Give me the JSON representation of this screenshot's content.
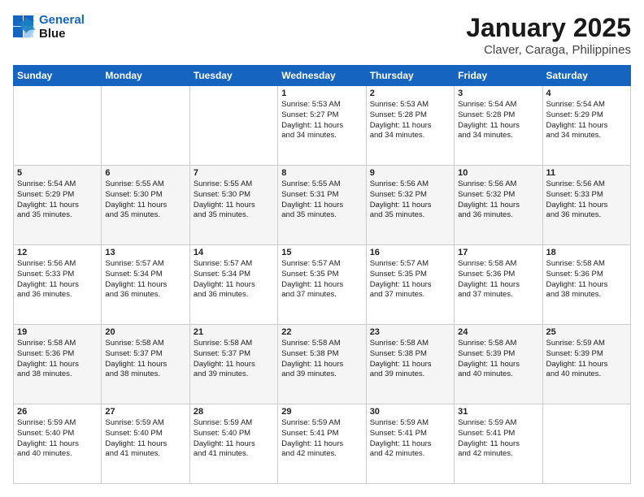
{
  "logo": {
    "line1": "General",
    "line2": "Blue"
  },
  "title": "January 2025",
  "subtitle": "Claver, Caraga, Philippines",
  "weekdays": [
    "Sunday",
    "Monday",
    "Tuesday",
    "Wednesday",
    "Thursday",
    "Friday",
    "Saturday"
  ],
  "weeks": [
    [
      {
        "day": "",
        "info": ""
      },
      {
        "day": "",
        "info": ""
      },
      {
        "day": "",
        "info": ""
      },
      {
        "day": "1",
        "info": "Sunrise: 5:53 AM\nSunset: 5:27 PM\nDaylight: 11 hours\nand 34 minutes."
      },
      {
        "day": "2",
        "info": "Sunrise: 5:53 AM\nSunset: 5:28 PM\nDaylight: 11 hours\nand 34 minutes."
      },
      {
        "day": "3",
        "info": "Sunrise: 5:54 AM\nSunset: 5:28 PM\nDaylight: 11 hours\nand 34 minutes."
      },
      {
        "day": "4",
        "info": "Sunrise: 5:54 AM\nSunset: 5:29 PM\nDaylight: 11 hours\nand 34 minutes."
      }
    ],
    [
      {
        "day": "5",
        "info": "Sunrise: 5:54 AM\nSunset: 5:29 PM\nDaylight: 11 hours\nand 35 minutes."
      },
      {
        "day": "6",
        "info": "Sunrise: 5:55 AM\nSunset: 5:30 PM\nDaylight: 11 hours\nand 35 minutes."
      },
      {
        "day": "7",
        "info": "Sunrise: 5:55 AM\nSunset: 5:30 PM\nDaylight: 11 hours\nand 35 minutes."
      },
      {
        "day": "8",
        "info": "Sunrise: 5:55 AM\nSunset: 5:31 PM\nDaylight: 11 hours\nand 35 minutes."
      },
      {
        "day": "9",
        "info": "Sunrise: 5:56 AM\nSunset: 5:32 PM\nDaylight: 11 hours\nand 35 minutes."
      },
      {
        "day": "10",
        "info": "Sunrise: 5:56 AM\nSunset: 5:32 PM\nDaylight: 11 hours\nand 36 minutes."
      },
      {
        "day": "11",
        "info": "Sunrise: 5:56 AM\nSunset: 5:33 PM\nDaylight: 11 hours\nand 36 minutes."
      }
    ],
    [
      {
        "day": "12",
        "info": "Sunrise: 5:56 AM\nSunset: 5:33 PM\nDaylight: 11 hours\nand 36 minutes."
      },
      {
        "day": "13",
        "info": "Sunrise: 5:57 AM\nSunset: 5:34 PM\nDaylight: 11 hours\nand 36 minutes."
      },
      {
        "day": "14",
        "info": "Sunrise: 5:57 AM\nSunset: 5:34 PM\nDaylight: 11 hours\nand 36 minutes."
      },
      {
        "day": "15",
        "info": "Sunrise: 5:57 AM\nSunset: 5:35 PM\nDaylight: 11 hours\nand 37 minutes."
      },
      {
        "day": "16",
        "info": "Sunrise: 5:57 AM\nSunset: 5:35 PM\nDaylight: 11 hours\nand 37 minutes."
      },
      {
        "day": "17",
        "info": "Sunrise: 5:58 AM\nSunset: 5:36 PM\nDaylight: 11 hours\nand 37 minutes."
      },
      {
        "day": "18",
        "info": "Sunrise: 5:58 AM\nSunset: 5:36 PM\nDaylight: 11 hours\nand 38 minutes."
      }
    ],
    [
      {
        "day": "19",
        "info": "Sunrise: 5:58 AM\nSunset: 5:36 PM\nDaylight: 11 hours\nand 38 minutes."
      },
      {
        "day": "20",
        "info": "Sunrise: 5:58 AM\nSunset: 5:37 PM\nDaylight: 11 hours\nand 38 minutes."
      },
      {
        "day": "21",
        "info": "Sunrise: 5:58 AM\nSunset: 5:37 PM\nDaylight: 11 hours\nand 39 minutes."
      },
      {
        "day": "22",
        "info": "Sunrise: 5:58 AM\nSunset: 5:38 PM\nDaylight: 11 hours\nand 39 minutes."
      },
      {
        "day": "23",
        "info": "Sunrise: 5:58 AM\nSunset: 5:38 PM\nDaylight: 11 hours\nand 39 minutes."
      },
      {
        "day": "24",
        "info": "Sunrise: 5:58 AM\nSunset: 5:39 PM\nDaylight: 11 hours\nand 40 minutes."
      },
      {
        "day": "25",
        "info": "Sunrise: 5:59 AM\nSunset: 5:39 PM\nDaylight: 11 hours\nand 40 minutes."
      }
    ],
    [
      {
        "day": "26",
        "info": "Sunrise: 5:59 AM\nSunset: 5:40 PM\nDaylight: 11 hours\nand 40 minutes."
      },
      {
        "day": "27",
        "info": "Sunrise: 5:59 AM\nSunset: 5:40 PM\nDaylight: 11 hours\nand 41 minutes."
      },
      {
        "day": "28",
        "info": "Sunrise: 5:59 AM\nSunset: 5:40 PM\nDaylight: 11 hours\nand 41 minutes."
      },
      {
        "day": "29",
        "info": "Sunrise: 5:59 AM\nSunset: 5:41 PM\nDaylight: 11 hours\nand 42 minutes."
      },
      {
        "day": "30",
        "info": "Sunrise: 5:59 AM\nSunset: 5:41 PM\nDaylight: 11 hours\nand 42 minutes."
      },
      {
        "day": "31",
        "info": "Sunrise: 5:59 AM\nSunset: 5:41 PM\nDaylight: 11 hours\nand 42 minutes."
      },
      {
        "day": "",
        "info": ""
      }
    ]
  ]
}
